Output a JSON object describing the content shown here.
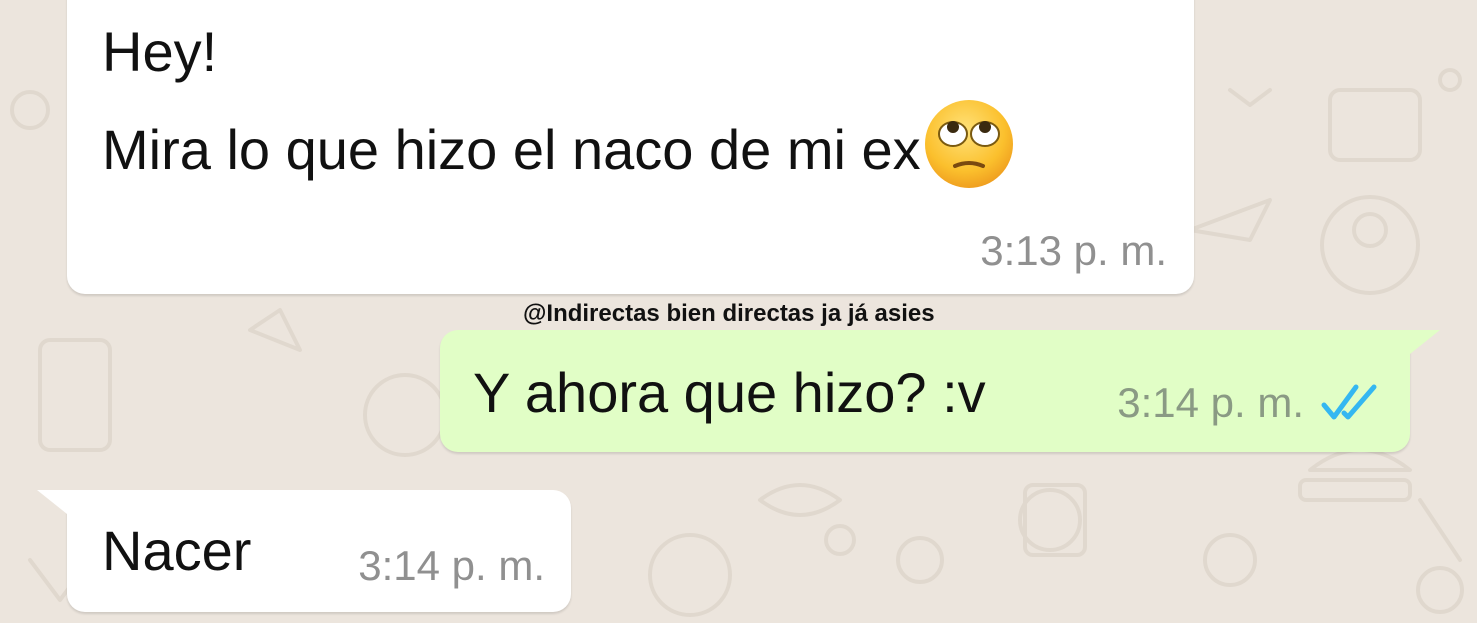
{
  "messages": [
    {
      "direction": "incoming",
      "lines": [
        "Hey!",
        "Mira lo que hizo el naco de mi ex"
      ],
      "emoji": "eye-roll-emoji",
      "time": "3:13 p. m."
    },
    {
      "direction": "outgoing",
      "text": "Y ahora que hizo? :v",
      "time": "3:14 p. m.",
      "status": "read",
      "status_icon": "double-check-icon"
    },
    {
      "direction": "incoming",
      "text": "Nacer",
      "time": "3:14 p. m."
    }
  ],
  "watermark": "@Indirectas bien directas ja já asies",
  "colors": {
    "background": "#ece5dd",
    "incoming_bubble": "#ffffff",
    "outgoing_bubble": "#e1fec6",
    "read_check": "#34b7f1"
  }
}
